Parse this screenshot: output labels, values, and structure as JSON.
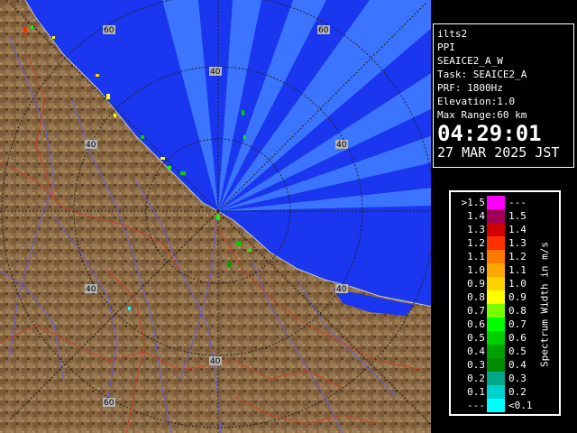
{
  "info": {
    "station": "ilts2",
    "mode": "PPI",
    "product": "SEAICE2_A_W",
    "task": "Task: SEAICE2_A",
    "prf": "PRF: 1800Hz",
    "elevation": "Elevation:1.0",
    "max_range": "Max Range:60 km",
    "time": "04:29:01",
    "date": "27 MAR 2025 JST"
  },
  "legend": {
    "title": "Spectrum Width in m/s",
    "rows": [
      {
        "lo": ">1.5",
        "hi": "---",
        "color": "#ff00ff"
      },
      {
        "lo": "1.4",
        "hi": "1.5",
        "color": "#a0005a"
      },
      {
        "lo": "1.3",
        "hi": "1.4",
        "color": "#d00000"
      },
      {
        "lo": "1.2",
        "hi": "1.3",
        "color": "#ff3000"
      },
      {
        "lo": "1.1",
        "hi": "1.2",
        "color": "#ff7800"
      },
      {
        "lo": "1.0",
        "hi": "1.1",
        "color": "#ffa800"
      },
      {
        "lo": "0.9",
        "hi": "1.0",
        "color": "#ffd200"
      },
      {
        "lo": "0.8",
        "hi": "0.9",
        "color": "#ffff00"
      },
      {
        "lo": "0.7",
        "hi": "0.8",
        "color": "#78ff00"
      },
      {
        "lo": "0.6",
        "hi": "0.7",
        "color": "#00ff00"
      },
      {
        "lo": "0.5",
        "hi": "0.6",
        "color": "#00d000"
      },
      {
        "lo": "0.4",
        "hi": "0.5",
        "color": "#00a000"
      },
      {
        "lo": "0.3",
        "hi": "0.4",
        "color": "#008c00"
      },
      {
        "lo": "0.2",
        "hi": "0.3",
        "color": "#00a888"
      },
      {
        "lo": "0.1",
        "hi": "0.2",
        "color": "#00d2d2"
      },
      {
        "lo": "---",
        "hi": "<0.1",
        "color": "#00ffff"
      }
    ]
  },
  "range_labels": {
    "r40": "40",
    "r60": "60"
  },
  "colors": {
    "sea": "#1a36ee",
    "beam": "#3a74ff",
    "land": "#8a6a44",
    "river": "#6a5cd6",
    "road": "#c8402a",
    "ring": "#222222"
  }
}
